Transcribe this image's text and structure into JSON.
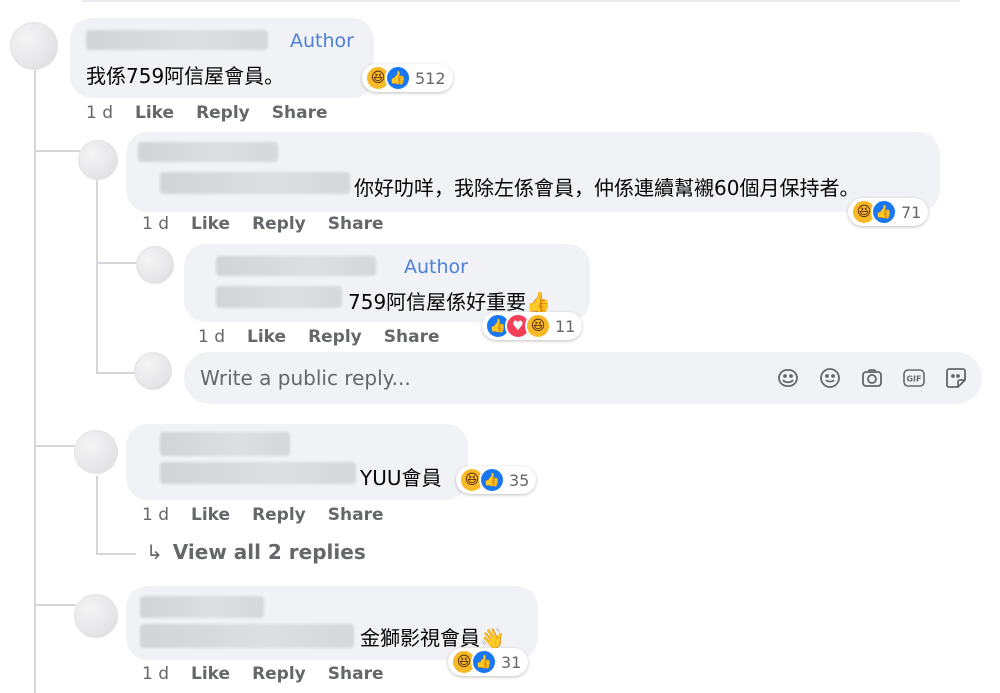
{
  "comments": [
    {
      "author_label": "Author",
      "text": "我係759阿信屋會員。",
      "reactions": {
        "icons": [
          "haha",
          "like"
        ],
        "count": "512"
      },
      "time": "1 d"
    },
    {
      "text": "你好叻咩，我除左係會員，仲係連續幫襯60個月保持者。",
      "reactions": {
        "icons": [
          "haha",
          "like"
        ],
        "count": "71"
      },
      "time": "1 d"
    },
    {
      "author_label": "Author",
      "text": "759阿信屋係好重要👍",
      "reactions": {
        "icons": [
          "like",
          "love",
          "haha"
        ],
        "count": "11"
      },
      "time": "1 d"
    },
    {
      "text": "YUU會員",
      "reactions": {
        "icons": [
          "haha",
          "like"
        ],
        "count": "35"
      },
      "time": "1 d"
    },
    {
      "text": "金獅影視會員👋",
      "reactions": {
        "icons": [
          "haha",
          "like"
        ],
        "count": "31"
      },
      "time": "1 d"
    }
  ],
  "actions": {
    "like": "Like",
    "reply": "Reply",
    "share": "Share"
  },
  "reply_box": {
    "placeholder": "Write a public reply..."
  },
  "view_replies": {
    "arrow": "↳",
    "label": "View all 2 replies"
  },
  "reply_tools": [
    "avatar-sticker-icon",
    "emoji-icon",
    "camera-icon",
    "gif-icon",
    "sticker-icon"
  ],
  "colors": {
    "author": "#4d7fd6",
    "bubble": "#f0f2f5",
    "meta": "#65676b",
    "like": "#1877f2",
    "haha": "#f7b928",
    "love": "#f33e58"
  }
}
